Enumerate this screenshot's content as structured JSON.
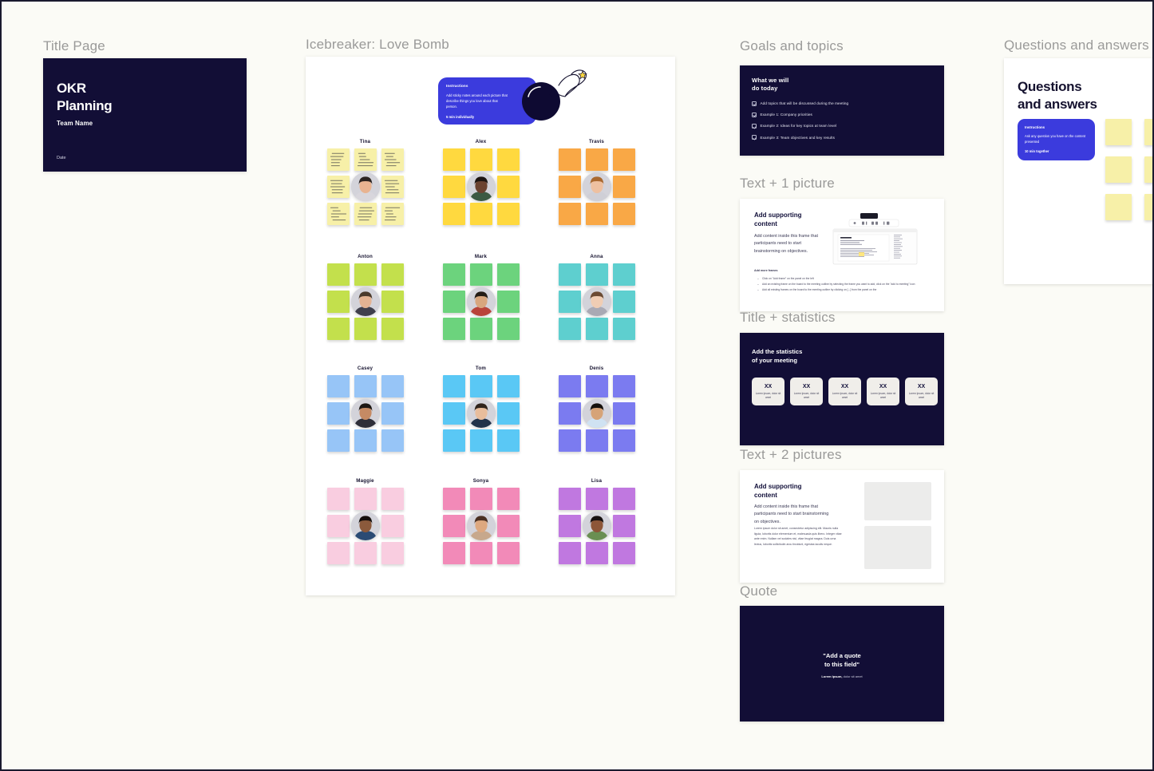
{
  "canvas": {
    "background": "#fbfbf6",
    "accent": "#3b3bdd",
    "dark": "#120e36"
  },
  "sections": {
    "title_page": "Title Page",
    "icebreaker": "Icebreaker: Love Bomb",
    "goals": "Goals and topics",
    "text_1_picture": "Text + 1 picture",
    "title_statistics": "Title + statistics",
    "text_2_pictures": "Text + 2 pictures",
    "quote": "Quote",
    "questions": "Questions and answers"
  },
  "title_slide": {
    "title": "OKR\nPlanning",
    "team": "Team Name",
    "date": "Date"
  },
  "icebreaker": {
    "instructions": {
      "heading": "Instructions",
      "body": "Add sticky notes around each picture that describe things you love about that person.",
      "footer": "5 min individually"
    },
    "people": [
      {
        "name": "Tina",
        "note_color": "#f7f0a8",
        "written": true,
        "avatar_hair": "#2b2320",
        "avatar_skin": "#e8b391",
        "avatar_shirt": "#d8d6dc"
      },
      {
        "name": "Alex",
        "note_color": "#ffd93f",
        "written": false,
        "avatar_hair": "#1d1512",
        "avatar_skin": "#6b4230",
        "avatar_shirt": "#3c5a43"
      },
      {
        "name": "Travis",
        "note_color": "#f9a846",
        "written": false,
        "avatar_hair": "#a9682f",
        "avatar_skin": "#eec0a0",
        "avatar_shirt": "#cfcfd6"
      },
      {
        "name": "Anton",
        "note_color": "#c3e04c",
        "written": false,
        "avatar_hair": "#4a3a2c",
        "avatar_skin": "#e4b393",
        "avatar_shirt": "#40404c"
      },
      {
        "name": "Mark",
        "note_color": "#6cd37d",
        "written": false,
        "avatar_hair": "#241c16",
        "avatar_skin": "#d8a67e",
        "avatar_shirt": "#b9443a"
      },
      {
        "name": "Anna",
        "note_color": "#5ecfcf",
        "written": false,
        "avatar_hair": "#6b4a33",
        "avatar_skin": "#f0cdb4",
        "avatar_shirt": "#a9a9b4"
      },
      {
        "name": "Casey",
        "note_color": "#97c5f7",
        "written": false,
        "avatar_hair": "#1c1714",
        "avatar_skin": "#c58a64",
        "avatar_shirt": "#2e2e38"
      },
      {
        "name": "Tom",
        "note_color": "#5ac8f5",
        "written": false,
        "avatar_hair": "#30241c",
        "avatar_skin": "#e8bd9c",
        "avatar_shirt": "#22324a"
      },
      {
        "name": "Denis",
        "note_color": "#7b7bf0",
        "written": false,
        "avatar_hair": "#15100c",
        "avatar_skin": "#d6a377",
        "avatar_shirt": "#cfe2f2"
      },
      {
        "name": "Maggie",
        "note_color": "#f9cde0",
        "written": false,
        "avatar_hair": "#140f0c",
        "avatar_skin": "#8b5a3c",
        "avatar_shirt": "#2b4b74"
      },
      {
        "name": "Sonya",
        "note_color": "#f28ab8",
        "written": false,
        "avatar_hair": "#4a3022",
        "avatar_skin": "#dda87f",
        "avatar_shirt": "#c7a88c"
      },
      {
        "name": "Lisa",
        "note_color": "#c078e0",
        "written": false,
        "avatar_hair": "#161010",
        "avatar_skin": "#8d5638",
        "avatar_shirt": "#6a8f52"
      }
    ]
  },
  "goals_slide": {
    "heading": "What we will\ndo today",
    "items": [
      "Add topics that will be discussed during the meeting",
      "Example 1: Company priorities",
      "Example 2: Ideas for key topics at team level",
      "Example 3: Team objectives and key results"
    ]
  },
  "pic1_slide": {
    "heading": "Add supporting\ncontent",
    "body": "Add content inside this frame that participants need to start brainstorming on objectives.",
    "more_label": "Add more frames",
    "more_items": [
      "Click on \"Add frame\" on the panel on the left",
      "Add an existing frame on the board to the meeting outline by selecting the frame you want to add, click on the \"add to meeting\" icon",
      "Add all existing frames on the board to the meeting outline by clicking on [...] from the panel on the"
    ]
  },
  "stats_slide": {
    "heading": "Add the statistics\nof your meeting",
    "boxes": [
      {
        "value": "XX",
        "label": "Lorem Ipsum, dolor sit amet"
      },
      {
        "value": "XX",
        "label": "Lorem Ipsum, dolor sit amet"
      },
      {
        "value": "XX",
        "label": "Lorem Ipsum, dolor sit amet"
      },
      {
        "value": "XX",
        "label": "Lorem Ipsum, dolor sit amet"
      },
      {
        "value": "XX",
        "label": "Lorem Ipsum, dolor sit amet"
      }
    ]
  },
  "pic2_slide": {
    "heading": "Add supporting\ncontent",
    "body": "Add content inside this frame that participants need to start brainstorming on objectives.",
    "lorem": "Lorem ipsum dolor sit amet, consectetur adipiscing elit. Mauris nulla ligula, lobortis dolor elementum et, malesuada quis libero. Integer vitae ante enim. Nullam vel sodales nisl, vitae feugiat magna. Duis urna lectus, lobortis sollicitudin arcu tincidunt, egestas iaculis neque."
  },
  "quote_slide": {
    "text": "\"Add a quote\nto this field\"",
    "attribution_bold": "Lorem Ipsum,",
    "attribution_rest": " dolor sit amet"
  },
  "qa_slide": {
    "heading": "Questions\nand answers",
    "instructions": {
      "heading": "Instructions",
      "body": "Ask any question you have on the content presented",
      "footer": "10 min together"
    },
    "note_color": "#f7f0a8"
  }
}
